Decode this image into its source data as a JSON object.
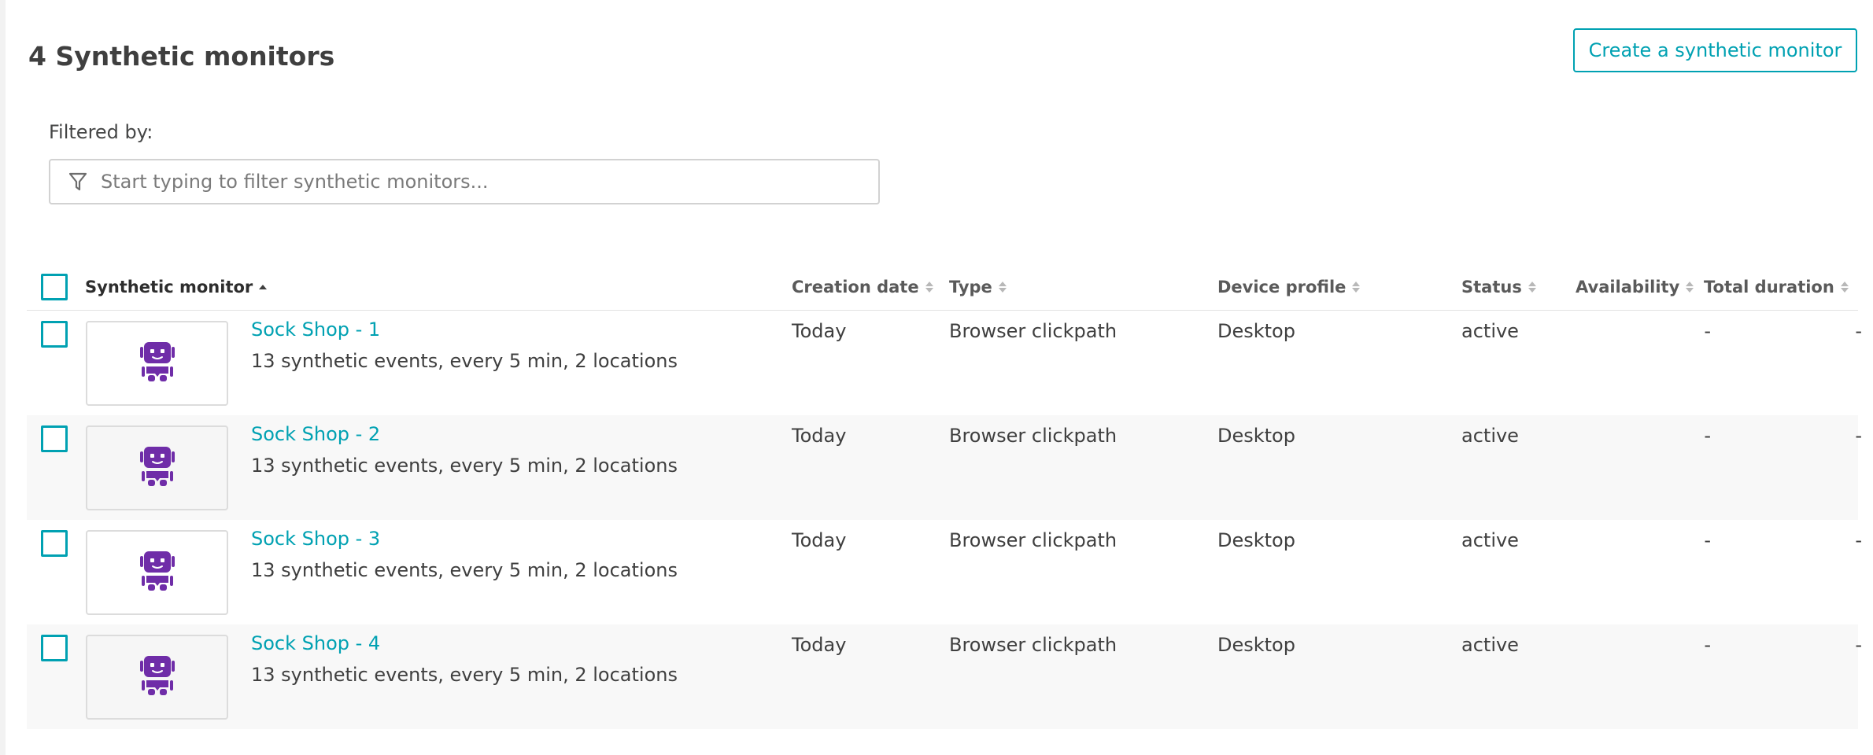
{
  "header": {
    "title": "4 Synthetic monitors",
    "create_label": "Create a synthetic monitor"
  },
  "filter": {
    "label": "Filtered by:",
    "placeholder": "Start typing to filter synthetic monitors..."
  },
  "table": {
    "columns": {
      "monitor": "Synthetic monitor",
      "creation_date": "Creation date",
      "type": "Type",
      "device_profile": "Device profile",
      "status": "Status",
      "availability": "Availability",
      "total_duration": "Total duration"
    },
    "rows": [
      {
        "name": "Sock Shop - 1",
        "description": "13 synthetic events, every 5 min, 2 locations",
        "creation_date": "Today",
        "type": "Browser clickpath",
        "device_profile": "Desktop",
        "status": "active",
        "availability": "-",
        "total_duration": "-"
      },
      {
        "name": "Sock Shop - 2",
        "description": "13 synthetic events, every 5 min, 2 locations",
        "creation_date": "Today",
        "type": "Browser clickpath",
        "device_profile": "Desktop",
        "status": "active",
        "availability": "-",
        "total_duration": "-"
      },
      {
        "name": "Sock Shop - 3",
        "description": "13 synthetic events, every 5 min, 2 locations",
        "creation_date": "Today",
        "type": "Browser clickpath",
        "device_profile": "Desktop",
        "status": "active",
        "availability": "-",
        "total_duration": "-"
      },
      {
        "name": "Sock Shop - 4",
        "description": "13 synthetic events, every 5 min, 2 locations",
        "creation_date": "Today",
        "type": "Browser clickpath",
        "device_profile": "Desktop",
        "status": "active",
        "availability": "-",
        "total_duration": "-"
      }
    ]
  },
  "colors": {
    "accent": "#00a1b2",
    "robot": "#6f2da8",
    "text": "#3f3f3f"
  },
  "icons": {
    "filter": "funnel-icon",
    "monitor": "robot-icon",
    "sort": "sort-icon"
  }
}
